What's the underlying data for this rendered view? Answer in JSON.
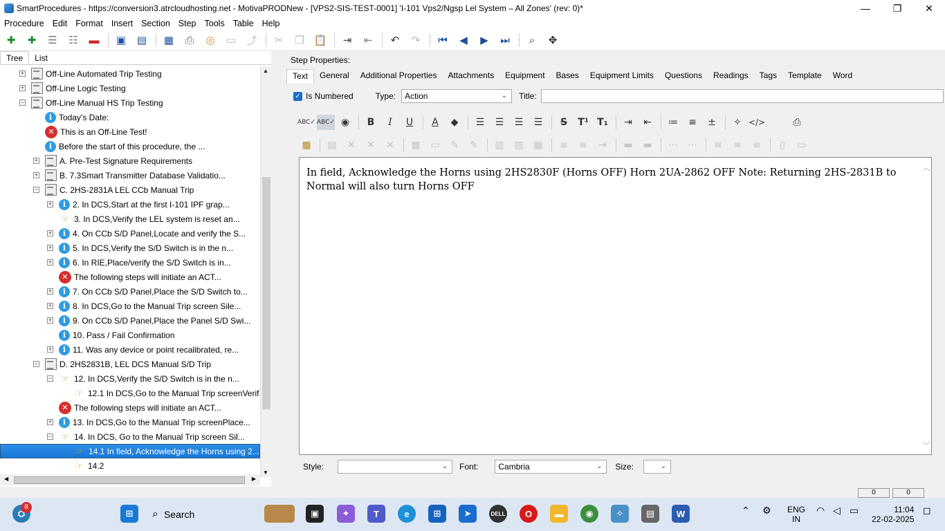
{
  "window": {
    "title": "SmartProcedures - https://conversion3.atrcloudhosting.net - MotivaPRODNew - [VPS2-SIS-TEST-0001] 'I-101 Vps2/Ngsp Lel System – All Zones' (rev: 0)*",
    "minimize": "—",
    "maximize": "❐",
    "close": "✕"
  },
  "menu": [
    "Procedure",
    "Edit",
    "Format",
    "Insert",
    "Section",
    "Step",
    "Tools",
    "Table",
    "Help"
  ],
  "left_tabs": [
    "Tree",
    "List"
  ],
  "tree": [
    {
      "indent": 0,
      "exp": "+",
      "icon": "doc",
      "label": "Off-Line Automated Trip Testing"
    },
    {
      "indent": 0,
      "exp": "+",
      "icon": "doc",
      "label": "Off-Line Logic Testing"
    },
    {
      "indent": 0,
      "exp": "−",
      "icon": "doc",
      "label": "Off-Line Manual HS Trip Testing"
    },
    {
      "indent": 1,
      "exp": "",
      "icon": "info",
      "label": "Today's Date:"
    },
    {
      "indent": 1,
      "exp": "",
      "icon": "err",
      "label": "This is an Off-Line Test!"
    },
    {
      "indent": 1,
      "exp": "",
      "icon": "info",
      "label": "Before the start of this procedure, the ..."
    },
    {
      "indent": 1,
      "exp": "+",
      "icon": "doc",
      "label": "A. Pre-Test Signature Requirements"
    },
    {
      "indent": 1,
      "exp": "+",
      "icon": "doc",
      "label": "B. 7.3Smart Transmitter Database Validatio..."
    },
    {
      "indent": 1,
      "exp": "−",
      "icon": "doc",
      "label": "C. 2HS-2831A LEL CCb Manual Trip"
    },
    {
      "indent": 2,
      "exp": "+",
      "icon": "info",
      "label": "2. In DCS,Start at the first I-101 IPF grap..."
    },
    {
      "indent": 2,
      "exp": "",
      "icon": "hand",
      "label": "3. In DCS,Verify the LEL system is reset an..."
    },
    {
      "indent": 2,
      "exp": "+",
      "icon": "info",
      "label": "4. On CCb S/D Panel,Locate and verify the S..."
    },
    {
      "indent": 2,
      "exp": "+",
      "icon": "info",
      "label": "5. In DCS,Verify the S/D Switch is in the n..."
    },
    {
      "indent": 2,
      "exp": "+",
      "icon": "info",
      "label": "6. In RIE,Place/verify the S/D Switch is in..."
    },
    {
      "indent": 2,
      "exp": "",
      "icon": "err",
      "label": "The following steps will initiate an ACT..."
    },
    {
      "indent": 2,
      "exp": "+",
      "icon": "info",
      "label": "7. On CCb S/D Panel,Place the S/D Switch to..."
    },
    {
      "indent": 2,
      "exp": "+",
      "icon": "info",
      "label": "8. In DCS,Go to the Manual Trip screen Sile..."
    },
    {
      "indent": 2,
      "exp": "+",
      "icon": "info",
      "label": "9. On CCb S/D Panel,Place the Panel S/D Swi..."
    },
    {
      "indent": 2,
      "exp": "",
      "icon": "info",
      "label": "10. Pass / Fail Confirmation"
    },
    {
      "indent": 2,
      "exp": "+",
      "icon": "info",
      "label": "11. Was any device or point recalibrated, re..."
    },
    {
      "indent": 1,
      "exp": "−",
      "icon": "doc",
      "label": "D. 2HS2831B, LEL DCS Manual S/D Trip"
    },
    {
      "indent": 2,
      "exp": "−",
      "icon": "hand",
      "label": "12. In DCS,Verify the S/D Switch is in the n..."
    },
    {
      "indent": 3,
      "exp": "",
      "icon": "hand",
      "label": "12.1 In DCS,Go to the Manual Trip screenVerif..."
    },
    {
      "indent": 2,
      "exp": "",
      "icon": "err",
      "label": "The following steps will initiate an ACT..."
    },
    {
      "indent": 2,
      "exp": "+",
      "icon": "info",
      "label": "13. In DCS,Go to the Manual Trip screenPlace..."
    },
    {
      "indent": 2,
      "exp": "−",
      "icon": "hand",
      "label": "14. In DCS, Go to the Manual Trip screen Sil..."
    },
    {
      "indent": 3,
      "exp": "",
      "icon": "hand",
      "label": "14.1 In field, Acknowledge the Horns using 2...",
      "selected": true
    },
    {
      "indent": 3,
      "exp": "",
      "icon": "hand",
      "label": "14.2"
    }
  ],
  "step_properties": {
    "label": "Step Properties:",
    "tabs": [
      "Text",
      "General",
      "Additional Properties",
      "Attachments",
      "Equipment",
      "Bases",
      "Equipment Limits",
      "Questions",
      "Readings",
      "Tags",
      "Template",
      "Word"
    ],
    "is_numbered_label": "Is Numbered",
    "type_label": "Type:",
    "type_value": "Action",
    "title_label": "Title:",
    "title_value": "",
    "editor_text": "In field, Acknowledge the Horns using 2HS2830F (Horns OFF)   Horn 2UA-2862 OFF      Note: Returning 2HS-2831B to Normal will also turn Horns OFF",
    "style_label": "Style:",
    "style_value": "",
    "font_label": "Font:",
    "font_value": "Cambria",
    "size_label": "Size:",
    "size_value": ""
  },
  "status": {
    "box1": "0",
    "box2": "0"
  },
  "taskbar": {
    "search_label": "Search",
    "notification_count": "8",
    "lang_line1": "ENG",
    "lang_line2": "IN",
    "time": "11:04",
    "date": "22-02-2025"
  }
}
